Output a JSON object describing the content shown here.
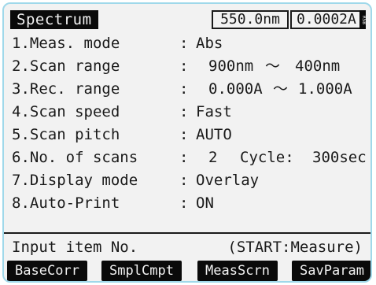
{
  "header": {
    "title": "Spectrum",
    "wavelength": "550.0nm",
    "absorbance": "0.0002A",
    "side_indicator": "RSB"
  },
  "settings": [
    {
      "label": "1.Meas. mode",
      "value": "Abs"
    },
    {
      "label": "2.Scan range",
      "value": "900nm",
      "tilde": "～",
      "value2": "400nm"
    },
    {
      "label": "3.Rec. range",
      "value": "0.000A",
      "tilde": "～",
      "value2": "1.000A"
    },
    {
      "label": "4.Scan speed",
      "value": "Fast"
    },
    {
      "label": "5.Scan pitch",
      "value": "AUTO"
    },
    {
      "label": "6.No. of scans",
      "value": "2",
      "value2_label": "Cycle:",
      "value2": "300sec"
    },
    {
      "label": "7.Display mode",
      "value": "Overlay"
    },
    {
      "label": "8.Auto-Print",
      "value": "ON"
    }
  ],
  "colon": ":",
  "prompt": {
    "text": "Input item No.",
    "hint": "(START:Measure)"
  },
  "function_keys": [
    "BaseCorr",
    "SmplCmpt",
    "MeasScrn",
    "SavParam"
  ]
}
